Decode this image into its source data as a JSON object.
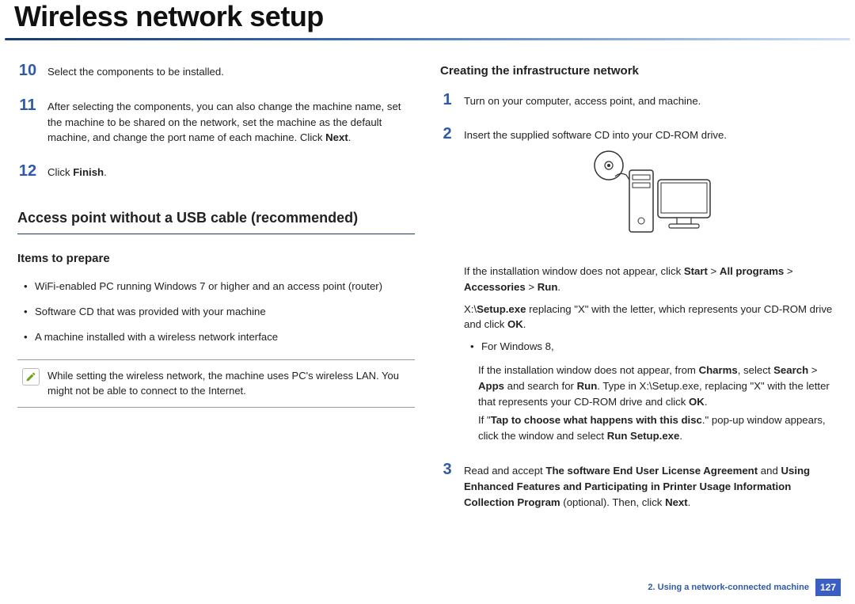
{
  "header": {
    "title": "Wireless network setup"
  },
  "left": {
    "steps": [
      {
        "num": "10",
        "text": "Select the components to be installed."
      },
      {
        "num": "11",
        "text_parts": [
          "After selecting the components, you can also change the machine name, set the machine to be shared on the network, set the machine as the default machine, and change the port name of each machine. Click ",
          "Next",
          "."
        ]
      },
      {
        "num": "12",
        "text_parts": [
          "Click ",
          "Finish",
          "."
        ]
      }
    ],
    "h2": "Access point without a USB cable (recommended)",
    "h3": "Items to prepare",
    "items": [
      "WiFi-enabled PC running Windows 7 or higher and an access point (router)",
      "Software CD that was provided with your machine",
      "A machine installed with a wireless network interface"
    ],
    "note": "While setting the wireless network, the machine uses PC's wireless LAN. You might not be able to connect to the Internet."
  },
  "right": {
    "h3": "Creating the infrastructure network",
    "step1": {
      "num": "1",
      "text": "Turn on your computer, access point, and machine."
    },
    "step2": {
      "num": "2",
      "text": "Insert the supplied software CD into your CD-ROM drive.",
      "after_illus_parts": [
        "If the installation window does not appear, click ",
        "Start",
        " > ",
        "All programs",
        " > ",
        "Accessories",
        " > ",
        "Run",
        "."
      ],
      "xpath_parts": [
        " X:\\",
        "Setup.exe",
        " replacing \"X\" with the letter, which represents your CD-ROM drive and click ",
        "OK",
        "."
      ],
      "win8_label": "For Windows 8,",
      "win8_parts": [
        "If the installation window does not appear, from ",
        "Charms",
        ", select ",
        "Search",
        " > ",
        "Apps",
        " and search for ",
        "Run",
        ". Type in X:\\Setup.exe, replacing \"X\" with the letter that represents your CD-ROM drive and click ",
        "OK",
        "."
      ],
      "tap_parts": [
        "If \"",
        "Tap to choose what happens with this disc",
        ".\" pop-up window appears, click the window and select ",
        "Run Setup.exe",
        "."
      ]
    },
    "step3": {
      "num": "3",
      "parts": [
        "Read and accept ",
        "The software End User License Agreement",
        "  and ",
        "Using Enhanced Features and Participating in Printer Usage Information Collection Program",
        " (optional). Then, click ",
        "Next",
        "."
      ]
    }
  },
  "footer": {
    "chapter": "2.  Using a network-connected machine",
    "page": "127"
  }
}
